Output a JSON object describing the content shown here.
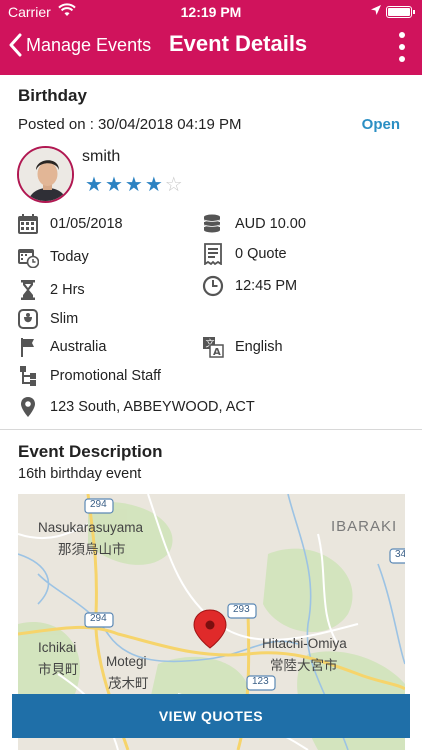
{
  "status_bar": {
    "carrier": "Carrier",
    "time": "12:19 PM"
  },
  "nav": {
    "back_label": "Manage Events",
    "title": "Event Details",
    "menu_icon": "kebab-icon"
  },
  "event": {
    "name": "Birthday",
    "posted": "Posted on : 30/04/2018 04:19 PM",
    "status": "Open"
  },
  "user": {
    "name": "smith",
    "rating": 4,
    "rating_max": 5
  },
  "details": {
    "date": "01/05/2018",
    "amount": "AUD 10.00",
    "day": "Today",
    "quotes": "0 Quote",
    "duration": "2 Hrs",
    "time": "12:45 PM",
    "body_type": "Slim",
    "country": "Australia",
    "language": "English",
    "category": "Promotional Staff",
    "address": "123 South, ABBEYWOOD, ACT"
  },
  "description": {
    "heading": "Event Description",
    "text": "16th birthday event"
  },
  "map": {
    "labels": {
      "nasukarasuyama": "Nasukarasuyama",
      "nasukarasuyama_jp": "那須烏山市",
      "ibaraki": "IBARAKI",
      "hitachi": "Hitachi-Omiya",
      "hitachi_jp": "常陸大宮市",
      "ichikai": "Ichikai",
      "ichikai_jp": "市貝町",
      "motegi": "Motegi",
      "motegi_jp": "茂木町",
      "r294a": "294",
      "r294b": "294",
      "r293": "293",
      "r123": "123",
      "r34": "34"
    }
  },
  "cta": {
    "label": "VIEW QUOTES"
  },
  "colors": {
    "header": "#d0135c",
    "accent": "#2b8fc4",
    "button": "#1f6fa8"
  }
}
